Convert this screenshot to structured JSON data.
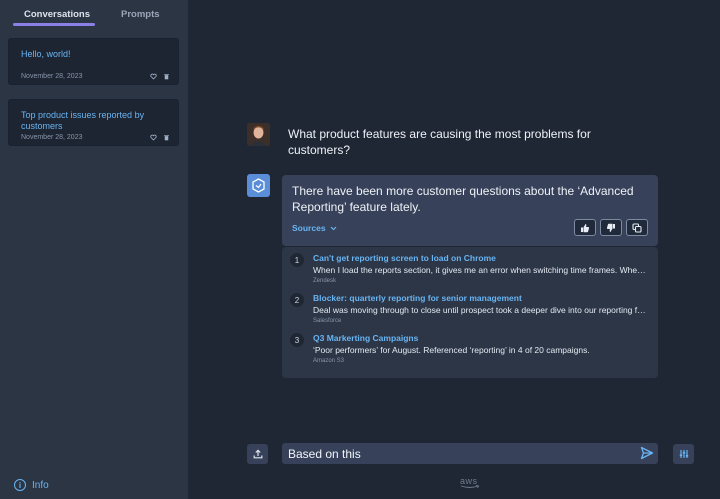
{
  "sidebar": {
    "tabs": [
      {
        "label": "Conversations",
        "active": true
      },
      {
        "label": "Prompts",
        "active": false
      }
    ],
    "conversations": [
      {
        "title": "Hello, world!",
        "date": "November 28, 2023"
      },
      {
        "title": "Top product issues reported by customers",
        "date": "November 28, 2023"
      }
    ],
    "info_label": "Info"
  },
  "chat": {
    "user_message": "What product features are causing the most problems for customers?",
    "bot_message": "There have been more customer questions about the ‘Advanced Reporting’ feature lately.",
    "sources_label": "Sources",
    "sources": [
      {
        "num": "1",
        "title": "Can't get reporting screen to load on Chrome",
        "desc": "When I load the reports section, it gives me an error when switching time frames. When I load",
        "origin": "Zendesk"
      },
      {
        "num": "2",
        "title": "Blocker: quarterly reporting for senior management",
        "desc": "Deal was moving through to close until prospect took a deeper dive into our reporting features",
        "origin": "Salesforce"
      },
      {
        "num": "3",
        "title": "Q3 Markerting Campaigns",
        "desc": "‘Poor performers’ for August. Referenced ‘reporting’ in 4 of 20 campaigns.",
        "origin": "Amazon S3"
      }
    ]
  },
  "input": {
    "value": "Based on this"
  },
  "footer": {
    "logo_text": "aws"
  },
  "colors": {
    "accent": "#69b4f2",
    "tab_underline": "#8b7fe8",
    "background": "#1f2735",
    "sidebar": "#2b3544"
  },
  "icons": [
    "heart-icon",
    "trash-icon",
    "info-icon",
    "chevron-down-icon",
    "thumbs-up-icon",
    "thumbs-down-icon",
    "copy-icon",
    "upload-icon",
    "send-icon",
    "settings-sliders-icon"
  ]
}
